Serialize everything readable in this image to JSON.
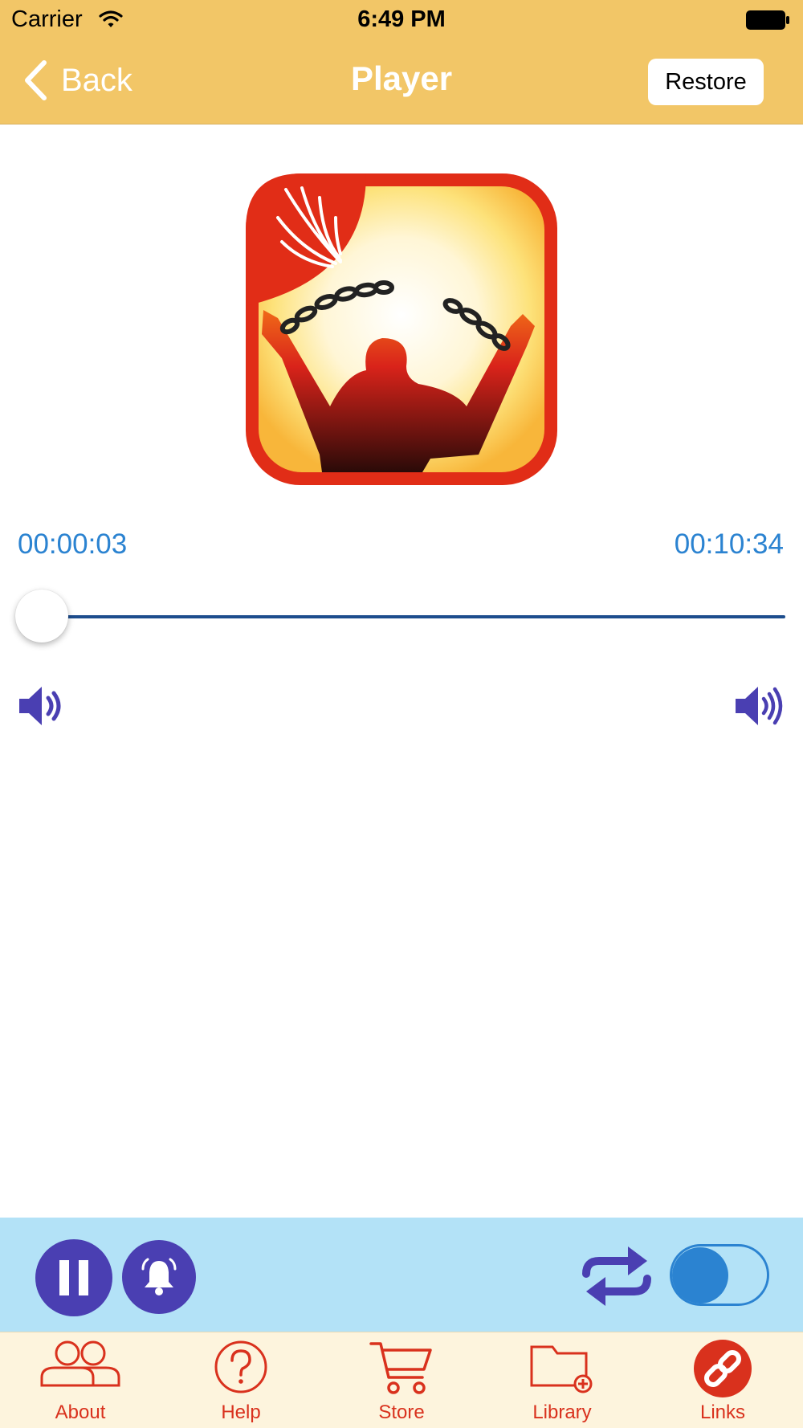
{
  "status_bar": {
    "carrier": "Carrier",
    "time": "6:49 PM"
  },
  "nav": {
    "back_label": "Back",
    "title": "Player",
    "restore_label": "Restore"
  },
  "player": {
    "elapsed": "00:00:03",
    "total": "00:10:34",
    "progress": 0.005
  },
  "controls": {
    "repeat_on": false
  },
  "tabs": [
    {
      "label": "About",
      "icon": "users-icon"
    },
    {
      "label": "Help",
      "icon": "question-icon"
    },
    {
      "label": "Store",
      "icon": "cart-icon"
    },
    {
      "label": "Library",
      "icon": "folder-add-icon"
    },
    {
      "label": "Links",
      "icon": "link-icon"
    }
  ],
  "colors": {
    "nav_background": "#f2c667",
    "accent_blue": "#2b83d1",
    "control_purple": "#4a3fb2",
    "controls_background": "#b3e2f7",
    "tab_background": "#fdf4dd",
    "tab_red": "#d9311d"
  }
}
